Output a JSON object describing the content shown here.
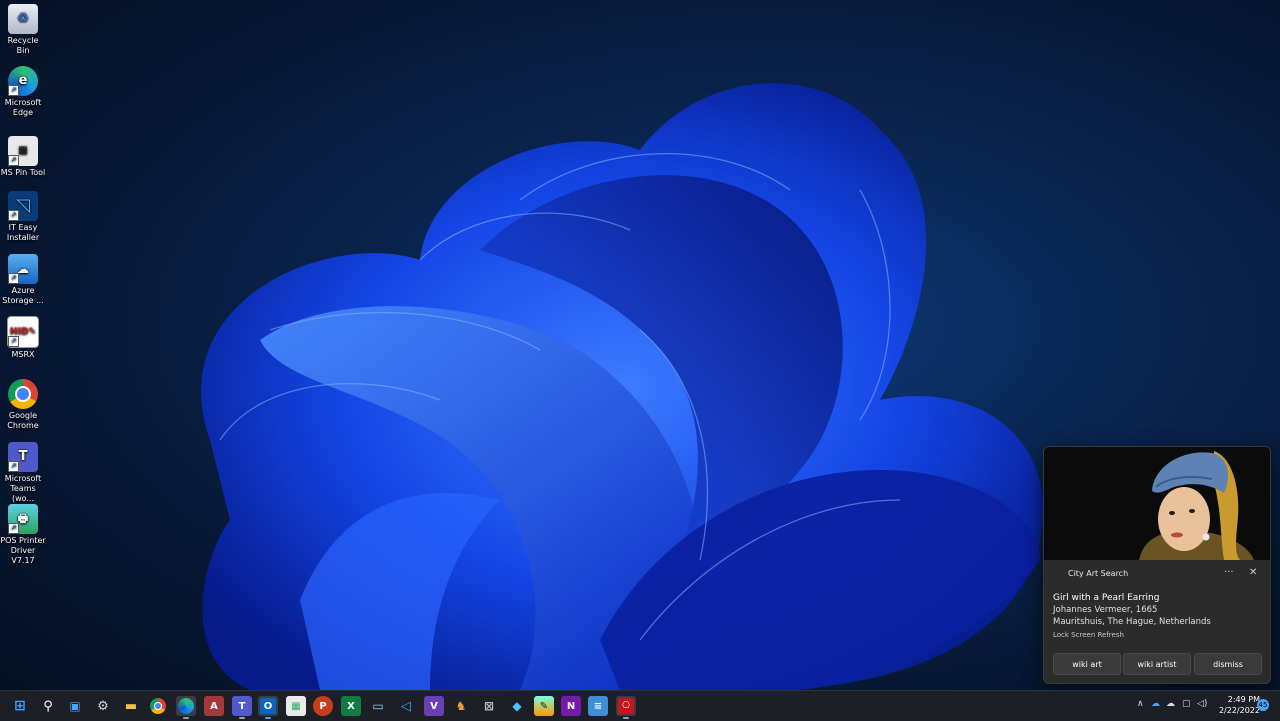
{
  "desktop": {
    "icons": [
      {
        "label_lines": [
          "Recycle Bin"
        ],
        "icon": "recycle-bin-icon"
      },
      {
        "label_lines": [
          "Microsoft",
          "Edge"
        ],
        "icon": "edge-icon"
      },
      {
        "label_lines": [
          "MS Pin Tool"
        ],
        "icon": "pin-tool-icon"
      },
      {
        "label_lines": [
          "IT Easy",
          "Installer"
        ],
        "icon": "installer-icon"
      },
      {
        "label_lines": [
          "Azure",
          "Storage ..."
        ],
        "icon": "azure-storage-icon"
      },
      {
        "label_lines": [
          "MSRX"
        ],
        "icon": "msrx-icon"
      },
      {
        "label_lines": [
          "Google",
          "Chrome"
        ],
        "icon": "chrome-icon"
      },
      {
        "label_lines": [
          "Microsoft",
          "Teams (wo..."
        ],
        "icon": "teams-icon"
      },
      {
        "label_lines": [
          "POS Printer",
          "Driver V7.17"
        ],
        "icon": "pos-printer-icon"
      }
    ]
  },
  "toast": {
    "app_name": "City Art Search",
    "more_glyph": "···",
    "close_glyph": "✕",
    "title": "Girl with a Pearl Earring",
    "line1": "Johannes Vermeer, 1665",
    "line2": "Mauritshuis, The Hague, Netherlands",
    "attribution": "Lock Screen Refresh",
    "buttons": [
      "wiki art",
      "wiki artist",
      "dismiss"
    ]
  },
  "taskbar": {
    "apps": [
      "start-icon",
      "search-icon",
      "task-view-icon",
      "settings-icon",
      "file-explorer-icon",
      "chrome-icon",
      "edge-icon",
      "access-icon",
      "teams-icon",
      "outlook-icon",
      "store-icon",
      "powerpoint-icon",
      "excel-icon",
      "remote-desktop-icon",
      "visual-studio-code-icon",
      "visual-studio-icon",
      "gitkraken-icon",
      "snipping-icon",
      "drop-icon",
      "paint-icon",
      "onenote-icon",
      "notepad-icon",
      "acrobat-icon"
    ],
    "clock_time": "2:49 PM",
    "clock_date": "2/22/2022",
    "notification_count": "45"
  },
  "colors": {
    "accent": "#1e5bff",
    "taskbar": "#1c1f26",
    "toast": "#2b2b2b"
  }
}
